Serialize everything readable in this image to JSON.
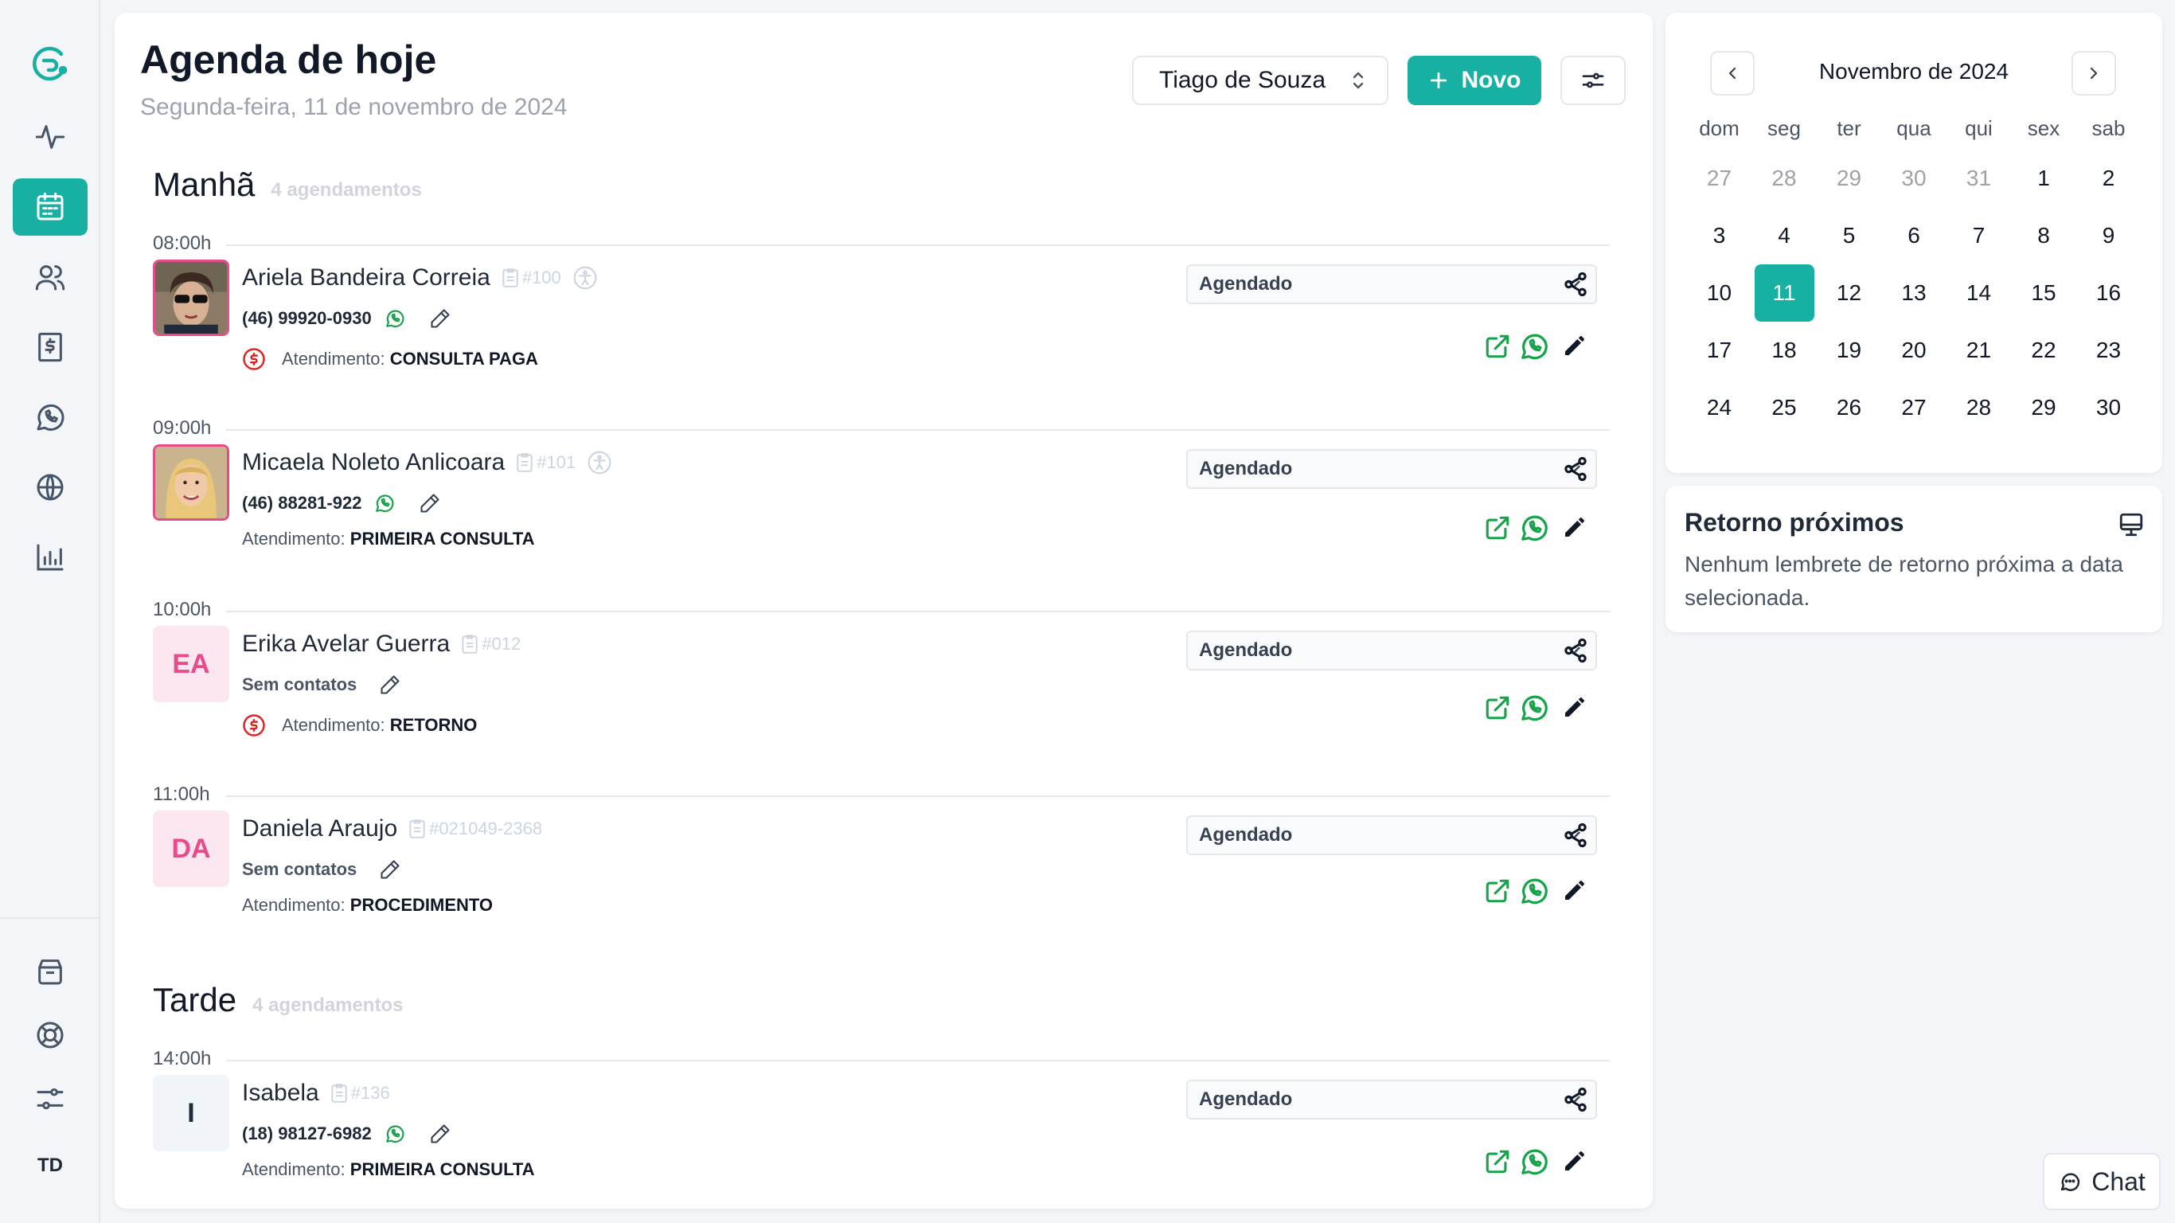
{
  "sidebar": {
    "top_items": [
      {
        "name": "logo",
        "icon": "logo-icon"
      },
      {
        "name": "activity",
        "icon": "activity-icon"
      },
      {
        "name": "agenda",
        "icon": "calendar-icon",
        "active": true
      },
      {
        "name": "patients",
        "icon": "users-icon"
      },
      {
        "name": "finance",
        "icon": "dollar-receipt-icon"
      },
      {
        "name": "whatsapp",
        "icon": "whatsapp-icon"
      },
      {
        "name": "web",
        "icon": "globe-icon"
      },
      {
        "name": "reports",
        "icon": "bar-chart-icon"
      }
    ],
    "bottom_items": [
      {
        "name": "store",
        "icon": "store-icon"
      },
      {
        "name": "help",
        "icon": "lifebuoy-icon"
      },
      {
        "name": "settings",
        "icon": "sliders-icon"
      }
    ],
    "user_initials": "TD"
  },
  "header": {
    "title": "Agenda de hoje",
    "date": "Segunda-feira, 11 de novembro de 2024",
    "professional": "Tiago de Souza",
    "new_label": "Novo"
  },
  "sections": [
    {
      "title": "Manhã",
      "count": "4 agendamentos"
    },
    {
      "title": "Tarde",
      "count": "4 agendamentos"
    }
  ],
  "appointments": [
    {
      "time": "08:00h",
      "name": "Ariela Bandeira Correia",
      "id": "#100",
      "phone": "(46) 99920-0930",
      "atend_label": "Atendimento:",
      "atend": "CONSULTA PAGA",
      "status": "Agendado"
    },
    {
      "time": "09:00h",
      "name": "Micaela Noleto Anlicoara",
      "id": "#101",
      "phone": "(46) 88281-922",
      "atend_label": "Atendimento:",
      "atend": "PRIMEIRA CONSULTA",
      "status": "Agendado"
    },
    {
      "time": "10:00h",
      "name": "Erika Avelar Guerra",
      "id": "#012",
      "initials": "EA",
      "phone": "Sem contatos",
      "atend_label": "Atendimento:",
      "atend": "RETORNO",
      "status": "Agendado"
    },
    {
      "time": "11:00h",
      "name": "Daniela Araujo",
      "id": "#021049-2368",
      "initials": "DA",
      "phone": "Sem contatos",
      "atend_label": "Atendimento:",
      "atend": "PROCEDIMENTO",
      "status": "Agendado"
    },
    {
      "time": "14:00h",
      "name": "Isabela",
      "id": "#136",
      "initials": "I",
      "phone": "(18) 98127-6982",
      "atend_label": "Atendimento:",
      "atend": "PRIMEIRA CONSULTA",
      "status": "Agendado"
    }
  ],
  "calendar": {
    "title": "Novembro de 2024",
    "weekdays": [
      "dom",
      "seg",
      "ter",
      "qua",
      "qui",
      "sex",
      "sab"
    ],
    "days": [
      [
        "27",
        "28",
        "29",
        "30",
        "31",
        "1",
        "2"
      ],
      [
        "3",
        "4",
        "5",
        "6",
        "7",
        "8",
        "9"
      ],
      [
        "10",
        "11",
        "12",
        "13",
        "14",
        "15",
        "16"
      ],
      [
        "17",
        "18",
        "19",
        "20",
        "21",
        "22",
        "23"
      ],
      [
        "24",
        "25",
        "26",
        "27",
        "28",
        "29",
        "30"
      ]
    ],
    "selected_day": "11"
  },
  "retorno": {
    "title": "Retorno próximos",
    "text": "Nenhum lembrete de retorno próxima a data selecionada."
  },
  "chat_label": "Chat",
  "colors": {
    "accent": "#17b0a2",
    "avatar_pink": "#e84b8a",
    "paid_red": "#dc2626",
    "whatsapp_green": "#16a34a"
  }
}
